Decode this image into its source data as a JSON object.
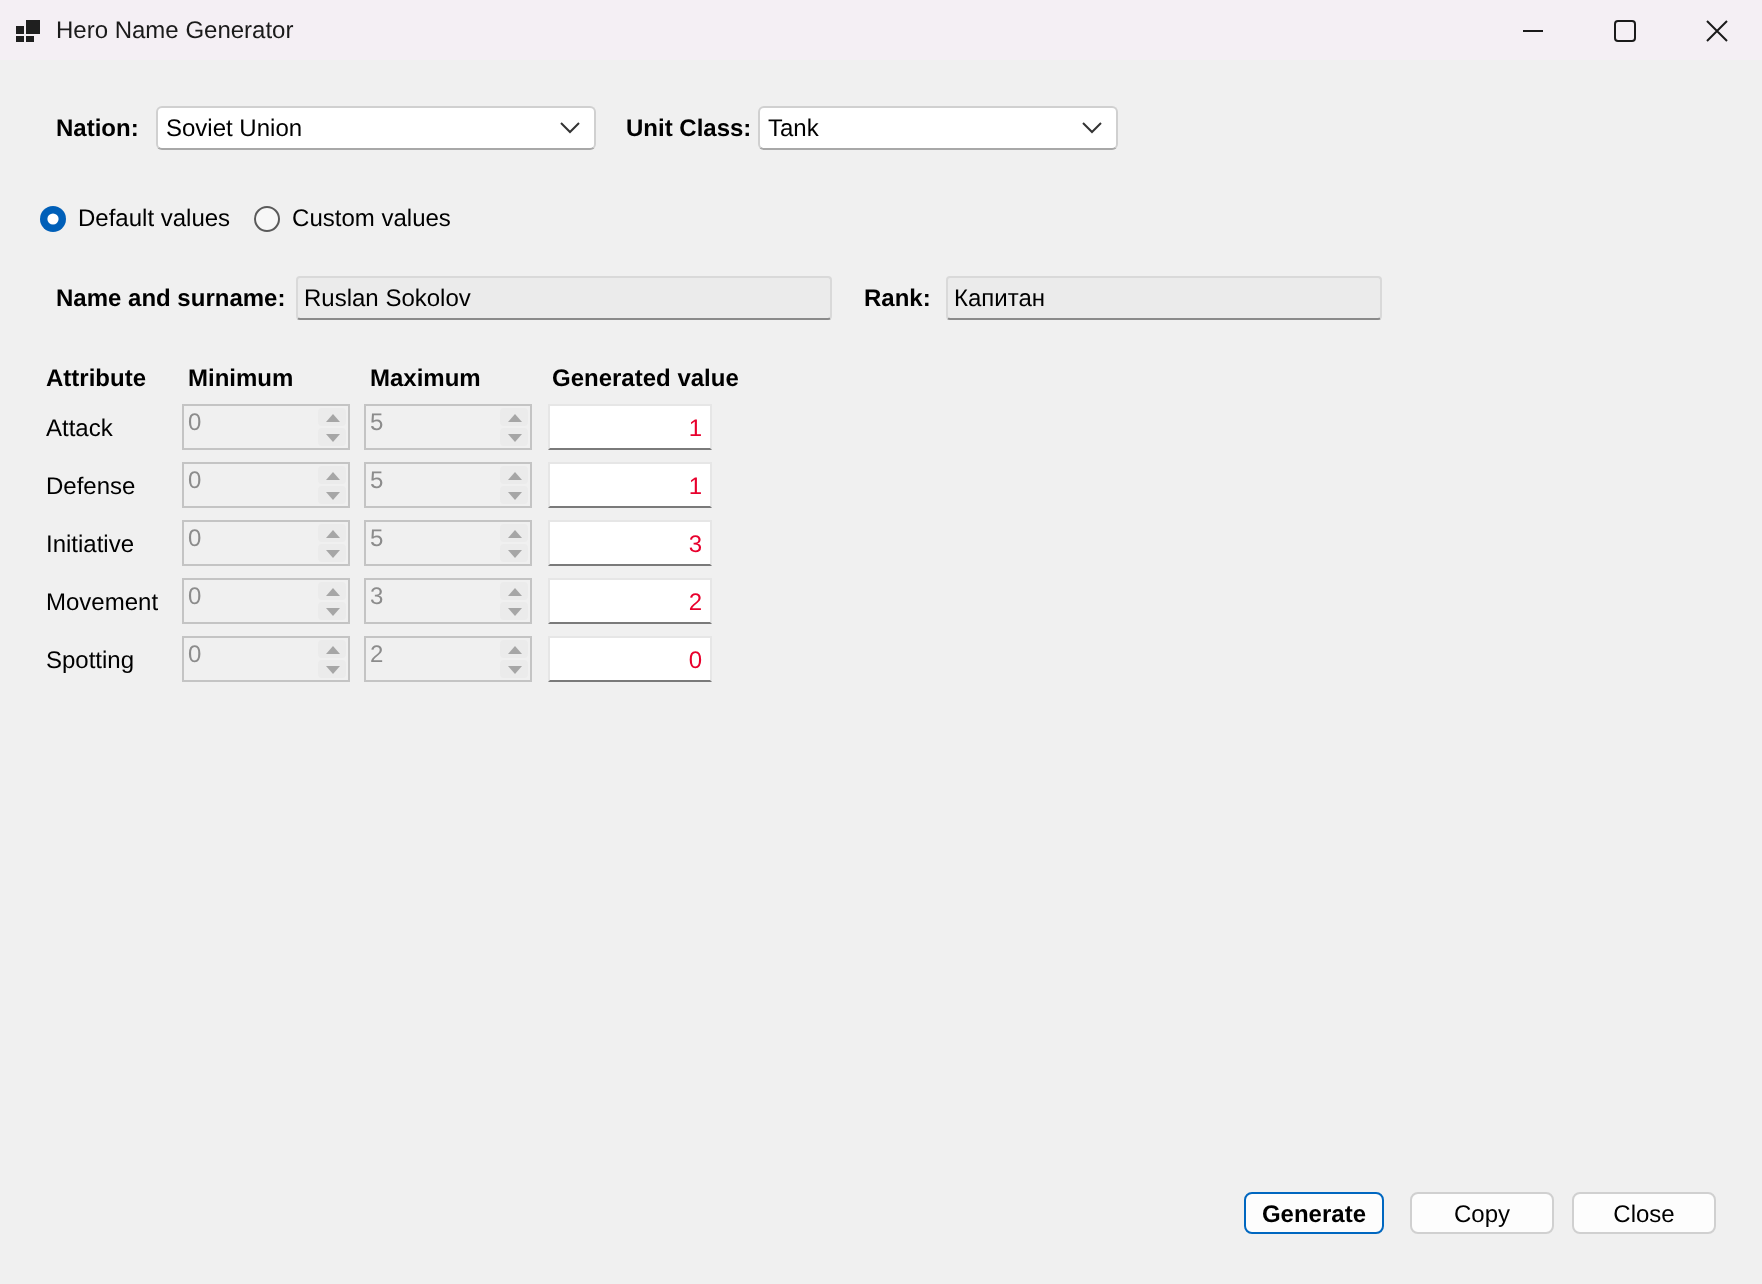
{
  "window": {
    "title": "Hero Name Generator"
  },
  "nation": {
    "label": "Nation:",
    "value": "Soviet Union"
  },
  "unit_class": {
    "label": "Unit Class:",
    "value": "Tank"
  },
  "value_mode": [
    {
      "label": "Default values",
      "selected": true
    },
    {
      "label": "Custom values",
      "selected": false
    }
  ],
  "name": {
    "label": "Name and surname:",
    "value": "Ruslan Sokolov"
  },
  "rank": {
    "label": "Rank:",
    "value": "Капитан"
  },
  "attributes": {
    "columns": [
      "Attribute",
      "Minimum",
      "Maximum",
      "Generated value"
    ],
    "rows": [
      {
        "name": "Attack",
        "minimum": "0",
        "maximum": "5",
        "generated": "1",
        "limits_disabled": true
      },
      {
        "name": "Defense",
        "minimum": "0",
        "maximum": "5",
        "generated": "1",
        "limits_disabled": true
      },
      {
        "name": "Initiative",
        "minimum": "0",
        "maximum": "5",
        "generated": "3",
        "limits_disabled": true
      },
      {
        "name": "Movement",
        "minimum": "0",
        "maximum": "3",
        "generated": "2",
        "limits_disabled": true
      },
      {
        "name": "Spotting",
        "minimum": "0",
        "maximum": "2",
        "generated": "0",
        "limits_disabled": true
      }
    ]
  },
  "buttons": [
    {
      "label": "Generate",
      "default": true
    },
    {
      "label": "Copy",
      "default": false
    },
    {
      "label": "Close",
      "default": false
    }
  ]
}
